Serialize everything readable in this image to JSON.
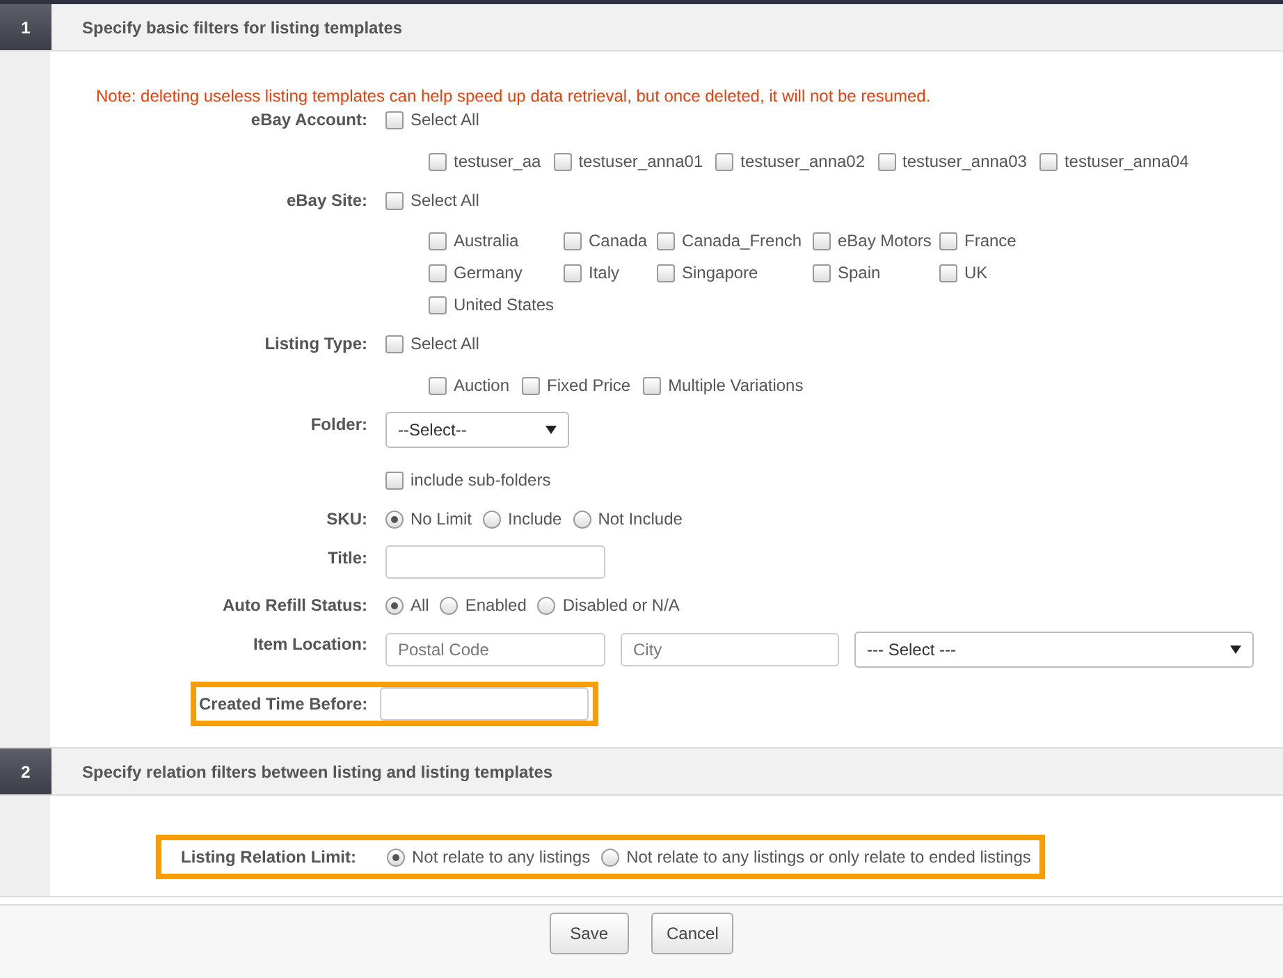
{
  "sections": [
    {
      "number": "1",
      "title": "Specify basic filters for listing templates",
      "note": "Note: deleting useless listing templates can help speed up data retrieval, but once deleted, it will not be resumed.",
      "fields": [
        {
          "kind": "checkboxes",
          "label": "eBay Account:",
          "select_all": {
            "label": "Select All",
            "checked": false
          },
          "options": [
            {
              "label": "testuser_aa",
              "checked": false
            },
            {
              "label": "testuser_anna01",
              "checked": false
            },
            {
              "label": "testuser_anna02",
              "checked": false
            },
            {
              "label": "testuser_anna03",
              "checked": false
            },
            {
              "label": "testuser_anna04",
              "checked": false
            }
          ]
        },
        {
          "kind": "grid",
          "label": "eBay Site:",
          "select_all": {
            "label": "Select All",
            "checked": false
          },
          "options": [
            {
              "label": "Australia",
              "checked": false
            },
            {
              "label": "Canada",
              "checked": false
            },
            {
              "label": "Canada_French",
              "checked": false
            },
            {
              "label": "eBay Motors",
              "checked": false
            },
            {
              "label": "France",
              "checked": false
            },
            {
              "label": "Germany",
              "checked": false
            },
            {
              "label": "Italy",
              "checked": false
            },
            {
              "label": "Singapore",
              "checked": false
            },
            {
              "label": "Spain",
              "checked": false
            },
            {
              "label": "UK",
              "checked": false
            },
            {
              "label": "United States",
              "checked": false
            }
          ]
        },
        {
          "kind": "checkboxes",
          "label": "Listing Type:",
          "select_all": {
            "label": "Select All",
            "checked": false
          },
          "options": [
            {
              "label": "Auction",
              "checked": false
            },
            {
              "label": "Fixed Price",
              "checked": false
            },
            {
              "label": "Multiple Variations",
              "checked": false
            }
          ]
        },
        {
          "kind": "select",
          "label": "Folder:",
          "value": "--Select--",
          "extra": {
            "label": "include sub-folders",
            "checked": false
          }
        },
        {
          "kind": "radio",
          "label": "SKU:",
          "options": [
            {
              "label": "No Limit",
              "selected": true
            },
            {
              "label": "Include",
              "selected": false
            },
            {
              "label": "Not Include",
              "selected": false
            }
          ]
        },
        {
          "kind": "input",
          "label": "Title:"
        },
        {
          "kind": "radio",
          "label": "Auto Refill Status:",
          "options": [
            {
              "label": "All",
              "selected": true
            },
            {
              "label": "Enabled",
              "selected": false
            },
            {
              "label": "Disabled or N/A",
              "selected": false
            }
          ]
        },
        {
          "kind": "location",
          "label": "Item Location:",
          "inputs": [
            {
              "placeholder": "Postal Code"
            },
            {
              "placeholder": "City"
            }
          ],
          "select": "--- Select ---"
        },
        {
          "kind": "input",
          "label": "Created Time Before:",
          "highlighted": true
        }
      ]
    },
    {
      "number": "2",
      "title": "Specify relation filters between listing and listing templates",
      "fields": [
        {
          "kind": "radio",
          "label": "Listing Relation Limit:",
          "highlighted": true,
          "options": [
            {
              "label": "Not relate to any listings",
              "selected": true
            },
            {
              "label": "Not relate to any listings or only relate to ended listings",
              "selected": false
            }
          ]
        }
      ]
    }
  ],
  "buttons": [
    {
      "label": "Save"
    },
    {
      "label": "Cancel"
    }
  ]
}
